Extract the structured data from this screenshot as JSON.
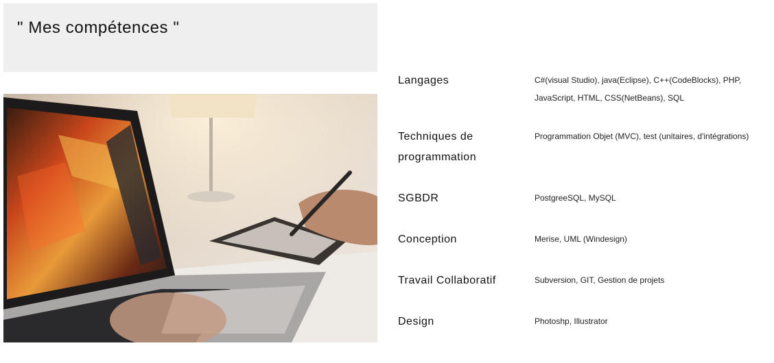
{
  "header": {
    "title": "\" Mes compétences \""
  },
  "photo": {
    "subject": "laptop-with-drawing-tablet"
  },
  "skills": [
    {
      "name": "Langages",
      "value": "C#(visual Studio), java(Eclipse), C++(CodeBlocks), PHP, JavaScript, HTML, CSS(NetBeans), SQL"
    },
    {
      "name": "Techniques de programmation",
      "value": "Programmation Objet (MVC), test (unitaires, d'intégrations)"
    },
    {
      "name": "SGBDR",
      "value": "PostgreeSQL, MySQL"
    },
    {
      "name": "Conception",
      "value": "Merise, UML (Windesign)"
    },
    {
      "name": "Travail Collaboratif",
      "value": "Subversion, GIT, Gestion de projets"
    },
    {
      "name": "Design",
      "value": "Photoshp, Illustrator"
    }
  ]
}
